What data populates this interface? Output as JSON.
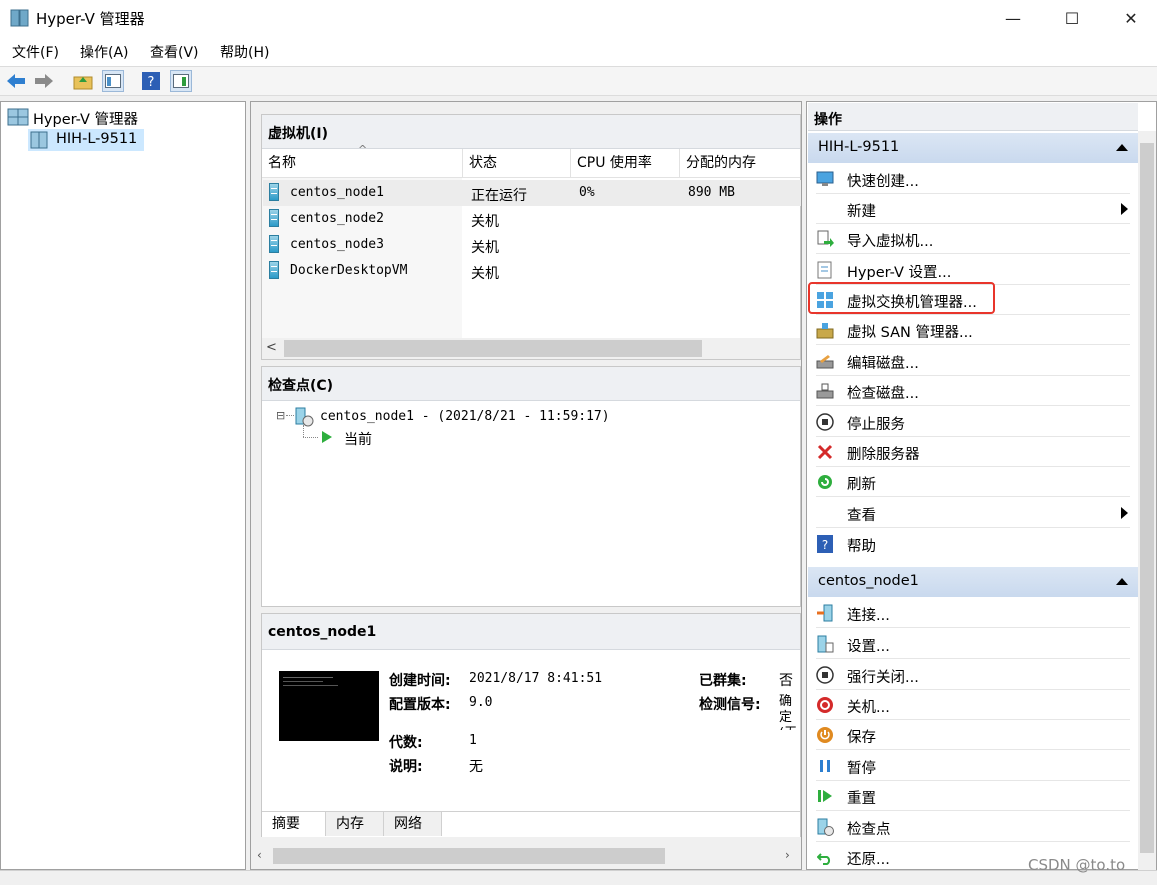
{
  "window": {
    "title": "Hyper-V 管理器",
    "minimize": "—",
    "maximize": "☐",
    "close": "✕"
  },
  "menu": [
    "文件(F)",
    "操作(A)",
    "查看(V)",
    "帮助(H)"
  ],
  "tree": {
    "root": "Hyper-V 管理器",
    "server": "HIH-L-9511"
  },
  "vms": {
    "header": "虚拟机(I)",
    "columns": [
      "名称",
      "状态",
      "CPU 使用率",
      "分配的内存"
    ],
    "rows": [
      {
        "name": "centos_node1",
        "state": "正在运行",
        "cpu": "0%",
        "mem": "890 MB"
      },
      {
        "name": "centos_node2",
        "state": "关机",
        "cpu": "",
        "mem": ""
      },
      {
        "name": "centos_node3",
        "state": "关机",
        "cpu": "",
        "mem": ""
      },
      {
        "name": "DockerDesktopVM",
        "state": "关机",
        "cpu": "",
        "mem": ""
      }
    ],
    "scroll_left": "<"
  },
  "checkpoints": {
    "header": "检查点(C)",
    "root": "centos_node1 - (2021/8/21 - 11:59:17)",
    "child": "当前"
  },
  "details": {
    "header": "centos_node1",
    "labels": {
      "created": "创建时间:",
      "version": "配置版本:",
      "generation": "代数:",
      "notes": "说明:",
      "clustered": "已群集:",
      "heartbeat": "检测信号:"
    },
    "values": {
      "created": "2021/8/17 8:41:51",
      "version": "9.0",
      "generation": "1",
      "notes": "无",
      "clustered": "否",
      "heartbeat": "确定(无应用程序数据)"
    },
    "tabs": [
      "摘要",
      "内存",
      "网络"
    ]
  },
  "actions": {
    "title": "操作",
    "server_header": "HIH-L-9511",
    "server_items": [
      "快速创建...",
      "新建",
      "导入虚拟机...",
      "Hyper-V 设置...",
      "虚拟交换机管理器...",
      "虚拟 SAN 管理器...",
      "编辑磁盘...",
      "检查磁盘...",
      "停止服务",
      "删除服务器",
      "刷新",
      "查看",
      "帮助"
    ],
    "vm_header": "centos_node1",
    "vm_items": [
      "连接...",
      "设置...",
      "强行关闭...",
      "关机...",
      "保存",
      "暂停",
      "重置",
      "检查点",
      "还原..."
    ]
  },
  "watermark": "CSDN @to.to",
  "colors": {
    "highlight_box": "#e8352b",
    "selected_row": "#e5f3fb",
    "header_blue": "#cbdcf0"
  }
}
